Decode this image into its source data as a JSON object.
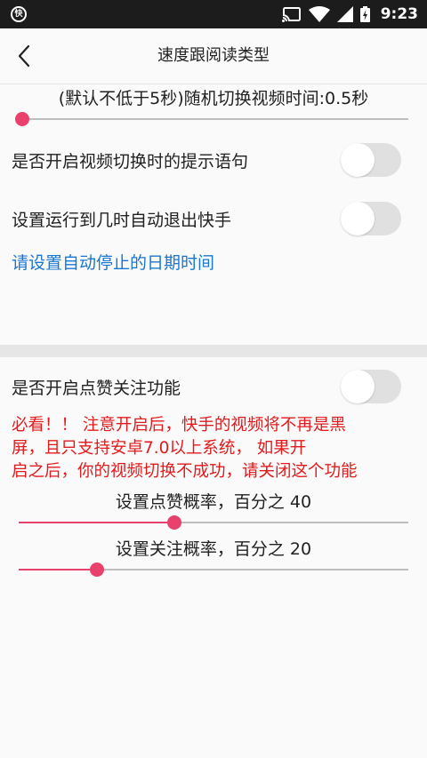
{
  "status_bar": {
    "app_icon_label": "快",
    "time": "9:23",
    "icons": [
      "cast-icon",
      "wifi-icon",
      "signal-icon",
      "battery-icon"
    ]
  },
  "app_bar": {
    "back_icon": "chevron-left-icon",
    "title": "速度跟阅读类型"
  },
  "video_switch_time": {
    "label": "(默认不低于5秒)随机切换视频时间:0.5秒",
    "slider_value_fraction": 0.0
  },
  "toggles": {
    "switch_prompt": {
      "label": "是否开启视频切换时的提示语句",
      "checked": false
    },
    "auto_exit": {
      "label": "设置运行到几时自动退出快手",
      "checked": false
    },
    "like_follow": {
      "label": "是否开启点赞关注功能",
      "checked": false
    }
  },
  "stop_date_link": "请设置自动停止的日期时间",
  "warning_lines": [
    "必看！！ 注意开启后，快手的视频将不再是黑",
    "屏，且只支持安卓7.0以上系统，          如果开",
    "启之后，你的视频切换不成功，请关闭这个功能"
  ],
  "like_probability": {
    "label": "设置点赞概率，百分之 40",
    "value": 40
  },
  "follow_probability": {
    "label": "设置关注概率，百分之 20",
    "value": 20
  },
  "colors": {
    "accent": "#e8416b",
    "link": "#1976d2",
    "warning": "#e31a1c",
    "status_bar": "#1c1c1c"
  }
}
